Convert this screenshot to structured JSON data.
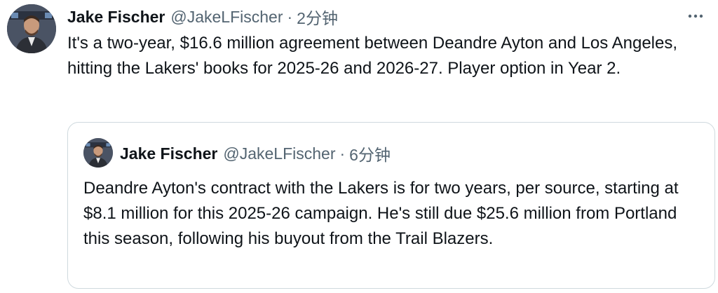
{
  "tweet": {
    "author": {
      "name": "Jake Fischer",
      "handle": "@JakeLFischer",
      "separator": "·",
      "time": "2分钟"
    },
    "text": "It's a two-year, $16.6 million agreement between Deandre Ayton and Los Angeles, hitting the Lakers' books for 2025-26 and 2026-27. Player option in Year 2.",
    "more_icon": "more-horizontal-icon"
  },
  "quoted_tweet": {
    "author": {
      "name": "Jake Fischer",
      "handle": "@JakeLFischer",
      "separator": "·",
      "time": "6分钟"
    },
    "text": "Deandre Ayton's contract with the Lakers is for two years, per source, starting at $8.1 million for this 2025-26 campaign. He's still due $25.6 million from Portland this season, following his buyout from the Trail Blazers."
  },
  "colors": {
    "primary_text": "#0f1419",
    "secondary_text": "#536471",
    "border": "#cfd9de"
  }
}
